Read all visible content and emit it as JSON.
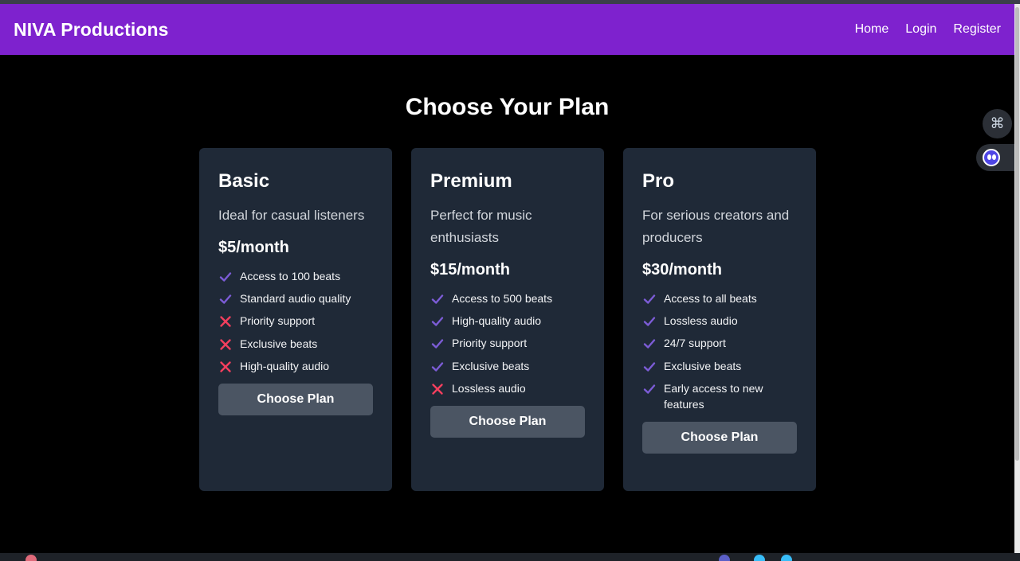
{
  "header": {
    "brand": "NIVA Productions",
    "nav": [
      "Home",
      "Login",
      "Register"
    ]
  },
  "page": {
    "title": "Choose Your Plan"
  },
  "colors": {
    "navbar": "#7e22ce",
    "card": "#1f2937",
    "button": "#4b5563",
    "check": "#7c5cd6",
    "cross": "#f43f5e"
  },
  "plans": [
    {
      "name": "Basic",
      "description": "Ideal for casual listeners",
      "price": "$5/month",
      "button": "Choose Plan",
      "features": [
        {
          "text": "Access to 100 beats",
          "included": true
        },
        {
          "text": "Standard audio quality",
          "included": true
        },
        {
          "text": "Priority support",
          "included": false
        },
        {
          "text": "Exclusive beats",
          "included": false
        },
        {
          "text": "High-quality audio",
          "included": false
        }
      ]
    },
    {
      "name": "Premium",
      "description": "Perfect for music enthusiasts",
      "price": "$15/month",
      "button": "Choose Plan",
      "features": [
        {
          "text": "Access to 500 beats",
          "included": true
        },
        {
          "text": "High-quality audio",
          "included": true
        },
        {
          "text": "Priority support",
          "included": true
        },
        {
          "text": "Exclusive beats",
          "included": true
        },
        {
          "text": "Lossless audio",
          "included": false
        }
      ]
    },
    {
      "name": "Pro",
      "description": "For serious creators and producers",
      "price": "$30/month",
      "button": "Choose Plan",
      "features": [
        {
          "text": "Access to all beats",
          "included": true
        },
        {
          "text": "Lossless audio",
          "included": true
        },
        {
          "text": "24/7 support",
          "included": true
        },
        {
          "text": "Exclusive beats",
          "included": true
        },
        {
          "text": "Early access to new features",
          "included": true
        }
      ]
    }
  ],
  "icons": {
    "side_widget": "command-icon",
    "side_tab": "assistant-icon",
    "included": "check-icon",
    "excluded": "x-icon"
  }
}
